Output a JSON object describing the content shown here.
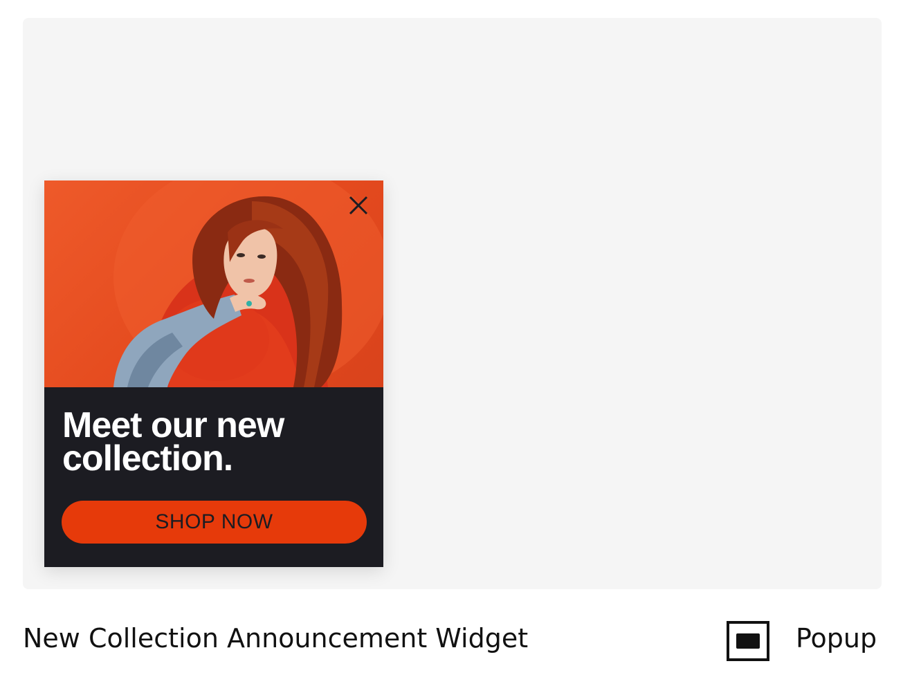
{
  "popup": {
    "headline": "Meet our new collection.",
    "cta_label": "SHOP NOW",
    "close_icon": "close-icon",
    "image_icon": "woman-portrait-image",
    "colors": {
      "image_background": "#e44a1e",
      "panel_background": "#1c1c22",
      "cta_background": "#e63a0a",
      "headline_text": "#ffffff"
    }
  },
  "footer": {
    "title": "New Collection Announcement Widget",
    "type_icon": "popup-window-icon",
    "type_label": "Popup"
  }
}
